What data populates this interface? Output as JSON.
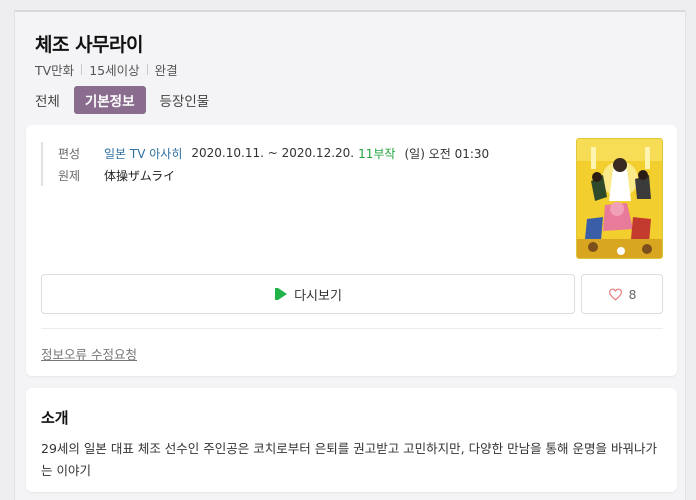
{
  "title": "체조 사무라이",
  "meta": [
    "TV만화",
    "15세이상",
    "완결"
  ],
  "tabs": [
    {
      "label": "전체",
      "active": false
    },
    {
      "label": "기본정보",
      "active": true
    },
    {
      "label": "등장인물",
      "active": false
    }
  ],
  "info": {
    "broadcast": {
      "label": "편성",
      "channel": "일본 TV 아사히",
      "dates": "2020.10.11. ~ 2020.12.20.",
      "episodes": "11부작",
      "airtime": "(일) 오전 01:30"
    },
    "original": {
      "label": "원제",
      "value": "体操ザムライ"
    }
  },
  "actions": {
    "rewatch_label": "다시보기",
    "like_count": "8"
  },
  "report_label": "정보오류 수정요청",
  "intro": {
    "heading": "소개",
    "text": "29세의 일본 대표 체조 선수인 주인공은 코치로부터 은퇴를 권고받고 고민하지만, 다양한 만남을 통해 운명을 바꿔나가는 이야기"
  },
  "colors": {
    "active_tab": "#8a6c8f",
    "channel_link": "#2f6f9f",
    "episodes": "#22a33b",
    "play_icon": "#1fb34a",
    "heart_icon": "#e57b7b"
  },
  "icons": [
    "play-icon",
    "heart-icon"
  ]
}
